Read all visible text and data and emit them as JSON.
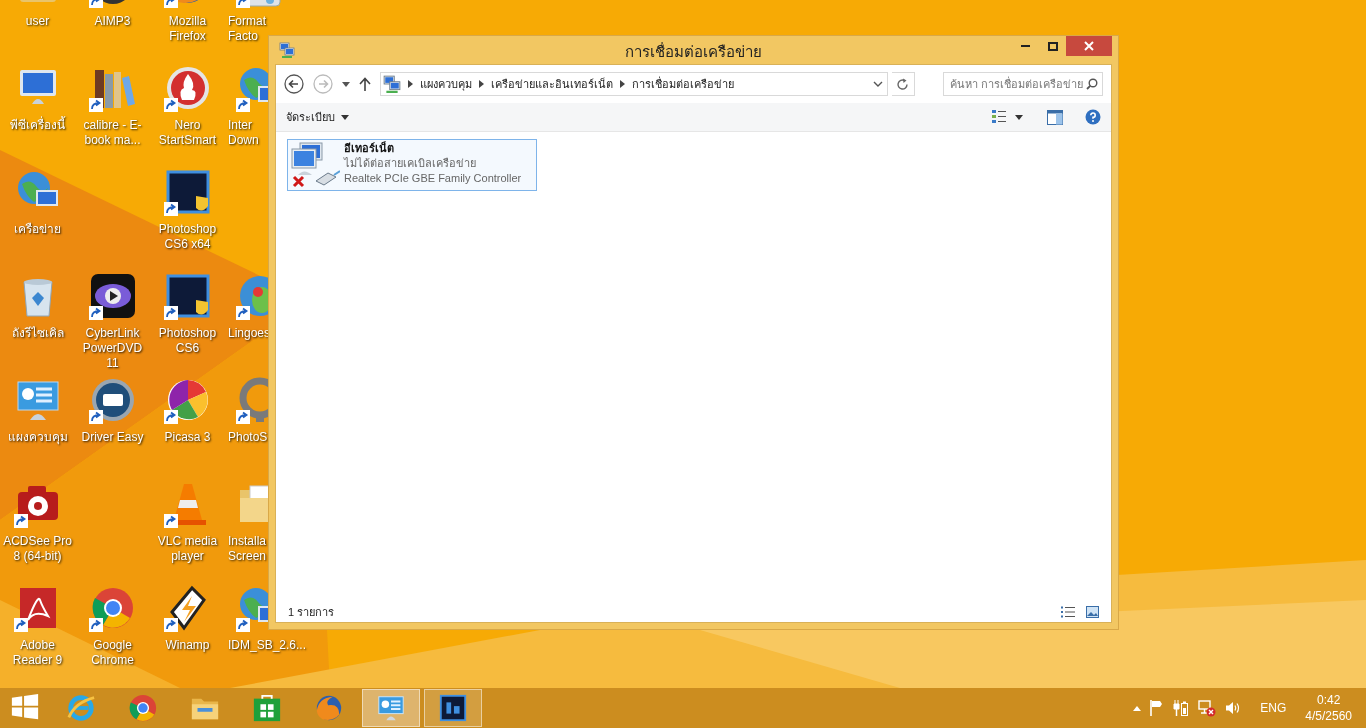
{
  "desktop": {
    "columns": [
      [
        {
          "label": "user",
          "kind": "user",
          "shortcut": false
        },
        {
          "label": "พีซีเครื่องนี้",
          "kind": "monitor",
          "shortcut": false
        },
        {
          "label": "เครือข่าย",
          "kind": "globe",
          "shortcut": false
        },
        {
          "label": "ถังรีไซเคิล",
          "kind": "bin",
          "shortcut": false
        },
        {
          "label": "แผงควบคุม",
          "kind": "panel",
          "shortcut": false
        },
        {
          "label": "ACDSee Pro 8 (64-bit)",
          "kind": "camera",
          "shortcut": true
        },
        {
          "label": "Adobe Reader 9",
          "kind": "pdf",
          "shortcut": true
        }
      ],
      [
        {
          "label": "AIMP3",
          "kind": "disc",
          "shortcut": true
        },
        {
          "label": "calibre - E-book ma...",
          "kind": "books",
          "shortcut": true
        },
        null,
        {
          "label": "CyberLink PowerDVD 11",
          "kind": "eye",
          "shortcut": true
        },
        {
          "label": "Driver Easy",
          "kind": "badge",
          "shortcut": true
        },
        null,
        {
          "label": "Google Chrome",
          "kind": "chrome",
          "shortcut": true
        }
      ],
      [
        {
          "label": "Mozilla Firefox",
          "kind": "fox",
          "shortcut": true
        },
        {
          "label": "Nero StartSmart",
          "kind": "flame",
          "shortcut": true
        },
        {
          "label": "Photoshop CS6 x64",
          "kind": "tile",
          "shortcut": true
        },
        {
          "label": "Photoshop CS6",
          "kind": "tile",
          "shortcut": true
        },
        {
          "label": "Picasa 3",
          "kind": "wheel",
          "shortcut": true
        },
        {
          "label": "VLC media player",
          "kind": "cone",
          "shortcut": true
        },
        {
          "label": "Winamp",
          "kind": "bolt",
          "shortcut": true
        }
      ],
      [
        {
          "label": "Format Facto",
          "kind": "drive",
          "shortcut": true
        },
        {
          "label": "Inter Down",
          "kind": "globe",
          "shortcut": true
        },
        null,
        {
          "label": "Lingoes",
          "kind": "bird",
          "shortcut": true
        },
        {
          "label": "PhotoS",
          "kind": "ring",
          "shortcut": true
        },
        {
          "label": "Installa Screen",
          "kind": "folder",
          "shortcut": false
        },
        {
          "label": "IDM_SB_2.6...",
          "kind": "globe",
          "shortcut": true
        }
      ]
    ]
  },
  "window": {
    "title": "การเชื่อมต่อเครือข่าย",
    "breadcrumbs": [
      "แผงควบคุม",
      "เครือข่ายและอินเทอร์เน็ต",
      "การเชื่อมต่อเครือข่าย"
    ],
    "search": {
      "placeholder": "ค้นหา การเชื่อมต่อเครือข่าย"
    },
    "toolbar": {
      "organize": "จัดระเบียบ"
    },
    "connections": [
      {
        "name": "อีเทอร์เน็ต",
        "status": "ไม่ได้ต่อสายเคเบิลเครือข่าย",
        "device": "Realtek PCIe GBE Family Controller",
        "connected": false,
        "selected": true
      }
    ],
    "status_bar": "1 รายการ"
  },
  "taskbar": {
    "items": [
      {
        "kind": "start",
        "open": false,
        "selected": false
      },
      {
        "kind": "ie",
        "open": false,
        "selected": false
      },
      {
        "kind": "chrome",
        "open": false,
        "selected": false
      },
      {
        "kind": "explorer",
        "open": false,
        "selected": false
      },
      {
        "kind": "store",
        "open": false,
        "selected": false
      },
      {
        "kind": "firefox",
        "open": false,
        "selected": false
      },
      {
        "kind": "panel",
        "open": true,
        "selected": true
      },
      {
        "kind": "ps",
        "open": true,
        "selected": false
      }
    ],
    "language": "ENG",
    "time": "0:42",
    "date": "4/5/2560"
  }
}
